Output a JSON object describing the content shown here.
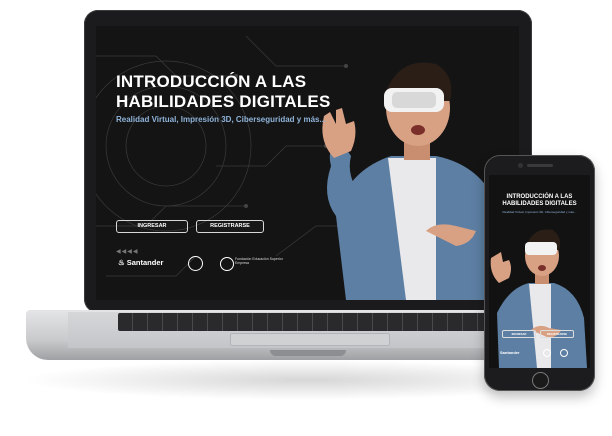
{
  "hero": {
    "title": "INTRODUCCIÓN A LAS HABILIDADES DIGITALES",
    "subtitle": "Realidad Virtual, Impresión 3D, Ciberseguridad y más..."
  },
  "buttons": {
    "login": "INGRESAR",
    "register": "REGISTRARSE"
  },
  "partners": {
    "santander": "Santander",
    "partner_small_text": "Fundación Educación Superior Empresa"
  },
  "phone": {
    "title": "INTRODUCCIÓN A LAS HABILIDADES DIGITALES",
    "subtitle": "Realidad Virtual, Impresión 3D, Ciberseguridad y más...",
    "login": "INGRESAR",
    "register": "REGISTRARSE",
    "santander": "Santander"
  },
  "colors": {
    "screen_bg": "#141414",
    "accent_text": "#8fb3d9",
    "laptop_frame": "#1b1b1d"
  },
  "icons": [
    "santander-flame-icon",
    "partner-logo-icon",
    "fundacion-logo-icon",
    "arrows-icon"
  ]
}
